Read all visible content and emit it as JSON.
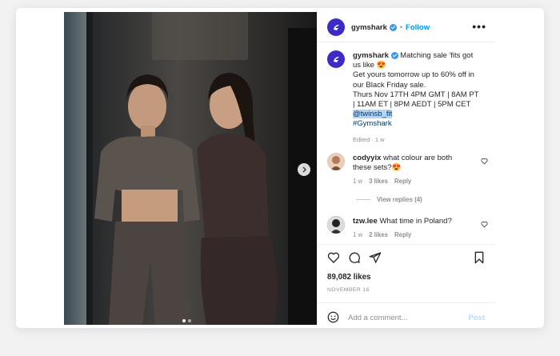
{
  "post": {
    "username": "gymshark",
    "follow_label": "Follow",
    "dot": "•",
    "more_label": "•••"
  },
  "caption": {
    "username": "gymshark",
    "line1": "Matching sale 'fits got",
    "line2": "us like 😍",
    "line3": "Get yours tomorrow up to 60% off in",
    "line4": "our Black Friday sale.",
    "line5": "Thurs Nov 17TH 4PM GMT | 8AM PT",
    "line6": "| 11AM ET | 8PM AEDT | 5PM CET",
    "mention": "@twinsb_fit",
    "hashtag": "#Gymshark",
    "meta": "Edited · 1 w"
  },
  "comments": [
    {
      "username": "codyyix",
      "text_line1": "what colour are both",
      "text_line2": "these sets?😍",
      "time": "1 w",
      "likes": "3 likes",
      "reply_label": "Reply",
      "view_replies": "View replies (4)"
    },
    {
      "username": "tzw.lee",
      "text": "What time in Poland?",
      "time": "1 w",
      "likes": "2 likes",
      "reply_label": "Reply"
    }
  ],
  "actions": {
    "likes_count": "89,082 likes",
    "date": "NOVEMBER 16"
  },
  "composer": {
    "placeholder": "Add a comment...",
    "post_label": "Post"
  },
  "carousel": {
    "current_index": 1,
    "total": 2
  },
  "icons": {
    "more": "more-icon",
    "heart": "heart-icon",
    "comment": "comment-icon",
    "share": "share-icon",
    "save": "save-icon",
    "emoji": "emoji-icon",
    "next": "chevron-right-icon",
    "verified": "verified-badge-icon"
  },
  "colors": {
    "brand": "#3d2bc8",
    "link": "#0095f6",
    "mention_highlight": "#b6d4f5"
  }
}
